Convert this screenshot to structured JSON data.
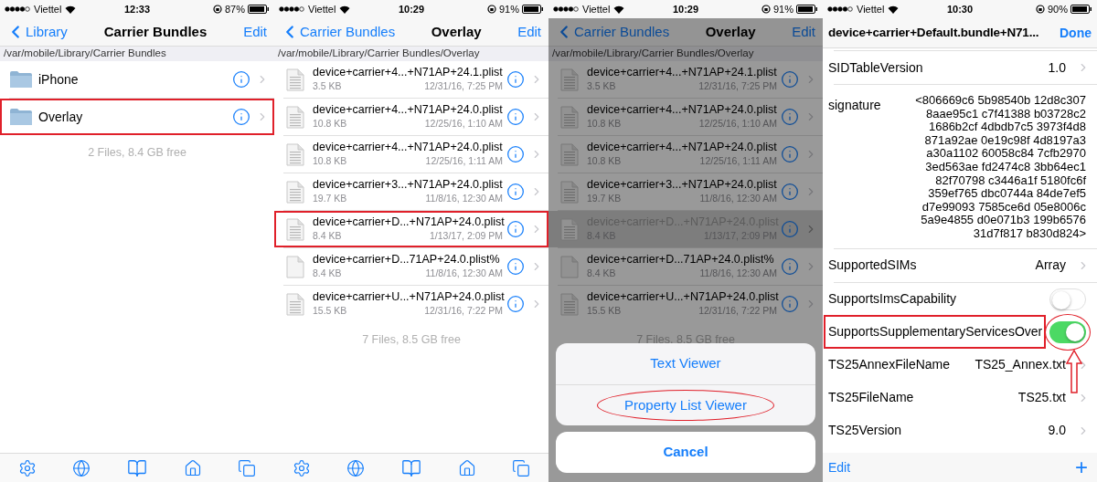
{
  "panels": [
    {
      "kind": "browser",
      "status": {
        "carrier": "Viettel",
        "time": "12:33",
        "battery": "87%"
      },
      "nav": {
        "back": "Library",
        "title": "Carrier Bundles",
        "action": "Edit"
      },
      "path": "/var/mobile/Library/Carrier Bundles",
      "dimmed": false,
      "toolbar": true,
      "items": [
        {
          "kind": "folder",
          "name": "iPhone",
          "selected": false,
          "annotated": false
        },
        {
          "kind": "folder",
          "name": "Overlay",
          "selected": false,
          "annotated": true
        }
      ],
      "footer": "2 Files, 8.4 GB free"
    },
    {
      "kind": "browser",
      "status": {
        "carrier": "Viettel",
        "time": "10:29",
        "battery": "91%"
      },
      "nav": {
        "back": "Carrier Bundles",
        "title": "Overlay",
        "action": "Edit"
      },
      "path": "/var/mobile/Library/Carrier Bundles/Overlay",
      "dimmed": false,
      "toolbar": true,
      "items": [
        {
          "kind": "document",
          "name": "device+carrier+4...+N71AP+24.1.plist",
          "size": "3.5 KB",
          "date": "12/31/16, 7:25 PM",
          "selected": false,
          "annotated": false
        },
        {
          "kind": "document",
          "name": "device+carrier+4...+N71AP+24.0.plist",
          "size": "10.8 KB",
          "date": "12/25/16, 1:10 AM",
          "selected": false,
          "annotated": false
        },
        {
          "kind": "document",
          "name": "device+carrier+4...+N71AP+24.0.plist",
          "size": "10.8 KB",
          "date": "12/25/16, 1:11 AM",
          "selected": false,
          "annotated": false
        },
        {
          "kind": "document",
          "name": "device+carrier+3...+N71AP+24.0.plist",
          "size": "19.7 KB",
          "date": "11/8/16, 12:30 AM",
          "selected": false,
          "annotated": false
        },
        {
          "kind": "document",
          "name": "device+carrier+D...+N71AP+24.0.plist",
          "size": "8.4 KB",
          "date": "1/13/17, 2:09 PM",
          "selected": false,
          "annotated": true
        },
        {
          "kind": "blank",
          "name": "device+carrier+D...71AP+24.0.plist%",
          "size": "8.4 KB",
          "date": "11/8/16, 12:30 AM",
          "selected": false,
          "annotated": false
        },
        {
          "kind": "document",
          "name": "device+carrier+U...+N71AP+24.0.plist",
          "size": "15.5 KB",
          "date": "12/31/16, 7:22 PM",
          "selected": false,
          "annotated": false
        }
      ],
      "footer": "7 Files, 8.5 GB free"
    },
    {
      "kind": "browser",
      "status": {
        "carrier": "Viettel",
        "time": "10:29",
        "battery": "91%"
      },
      "nav": {
        "back": "Carrier Bundles",
        "title": "Overlay",
        "action": "Edit"
      },
      "path": "/var/mobile/Library/Carrier Bundles/Overlay",
      "dimmed": true,
      "toolbar": false,
      "items": [
        {
          "kind": "document",
          "name": "device+carrier+4...+N71AP+24.1.plist",
          "size": "3.5 KB",
          "date": "12/31/16, 7:25 PM",
          "selected": false,
          "annotated": false
        },
        {
          "kind": "document",
          "name": "device+carrier+4...+N71AP+24.0.plist",
          "size": "10.8 KB",
          "date": "12/25/16, 1:10 AM",
          "selected": false,
          "annotated": false
        },
        {
          "kind": "document",
          "name": "device+carrier+4...+N71AP+24.0.plist",
          "size": "10.8 KB",
          "date": "12/25/16, 1:11 AM",
          "selected": false,
          "annotated": false
        },
        {
          "kind": "document",
          "name": "device+carrier+3...+N71AP+24.0.plist",
          "size": "19.7 KB",
          "date": "11/8/16, 12:30 AM",
          "selected": false,
          "annotated": false
        },
        {
          "kind": "document",
          "name": "device+carrier+D...+N71AP+24.0.plist",
          "size": "8.4 KB",
          "date": "1/13/17, 2:09 PM",
          "selected": true,
          "annotated": false
        },
        {
          "kind": "blank",
          "name": "device+carrier+D...71AP+24.0.plist%",
          "size": "8.4 KB",
          "date": "11/8/16, 12:30 AM",
          "selected": false,
          "annotated": false
        },
        {
          "kind": "document",
          "name": "device+carrier+U...+N71AP+24.0.plist",
          "size": "15.5 KB",
          "date": "12/31/16, 7:22 PM",
          "selected": false,
          "annotated": false
        }
      ],
      "footer": "7 Files, 8.5 GB free",
      "sheet": {
        "options": [
          {
            "label": "Text Viewer",
            "annotated": false
          },
          {
            "label": "Property List Viewer",
            "annotated": true
          }
        ],
        "cancel": "Cancel"
      }
    },
    {
      "kind": "plist",
      "status": {
        "carrier": "Viettel",
        "time": "10:30",
        "battery": "90%"
      },
      "title": "device+carrier+Default.bundle+N71...",
      "done": "Done",
      "rows": [
        {
          "kind": "value",
          "key": "SIDTableVersion",
          "value": "1.0",
          "annotated": false
        },
        {
          "kind": "data",
          "key": "signature",
          "lines": [
            "<806669c6 5b98540b 12d8c307",
            "8aae95c1 c7f41388 b03728c2",
            "1686b2cf 4dbdb7c5 3973f4d8",
            "871a92ae 0e19c98f 4d8197a3",
            "a30a1102 60058c84 7cfb2970",
            "3ed563ae fd2474c8 3bb64ec1",
            "82f70798 c3446a1f 5180fc6f",
            "359ef765 dbc0744a 84de7ef5",
            "d7e99093 7585ce6d 05e8006c",
            "5a9e4855 d0e071b3 199b6576",
            "31d7f817 b830d824>"
          ],
          "annotated": false
        },
        {
          "kind": "value",
          "key": "SupportedSIMs",
          "value": "Array",
          "annotated": false
        },
        {
          "kind": "toggle",
          "key": "SupportsImsCapability",
          "on": false,
          "annotated": false
        },
        {
          "kind": "toggle",
          "key": "SupportsSupplementaryServicesOver",
          "on": true,
          "annotated": true
        },
        {
          "kind": "value",
          "key": "TS25AnnexFileName",
          "value": "TS25_Annex.txt",
          "annotated": false
        },
        {
          "kind": "value",
          "key": "TS25FileName",
          "value": "TS25.txt",
          "annotated": false
        },
        {
          "kind": "value",
          "key": "TS25Version",
          "value": "9.0",
          "annotated": false
        }
      ],
      "bottom": {
        "edit": "Edit",
        "add": "+"
      }
    }
  ]
}
